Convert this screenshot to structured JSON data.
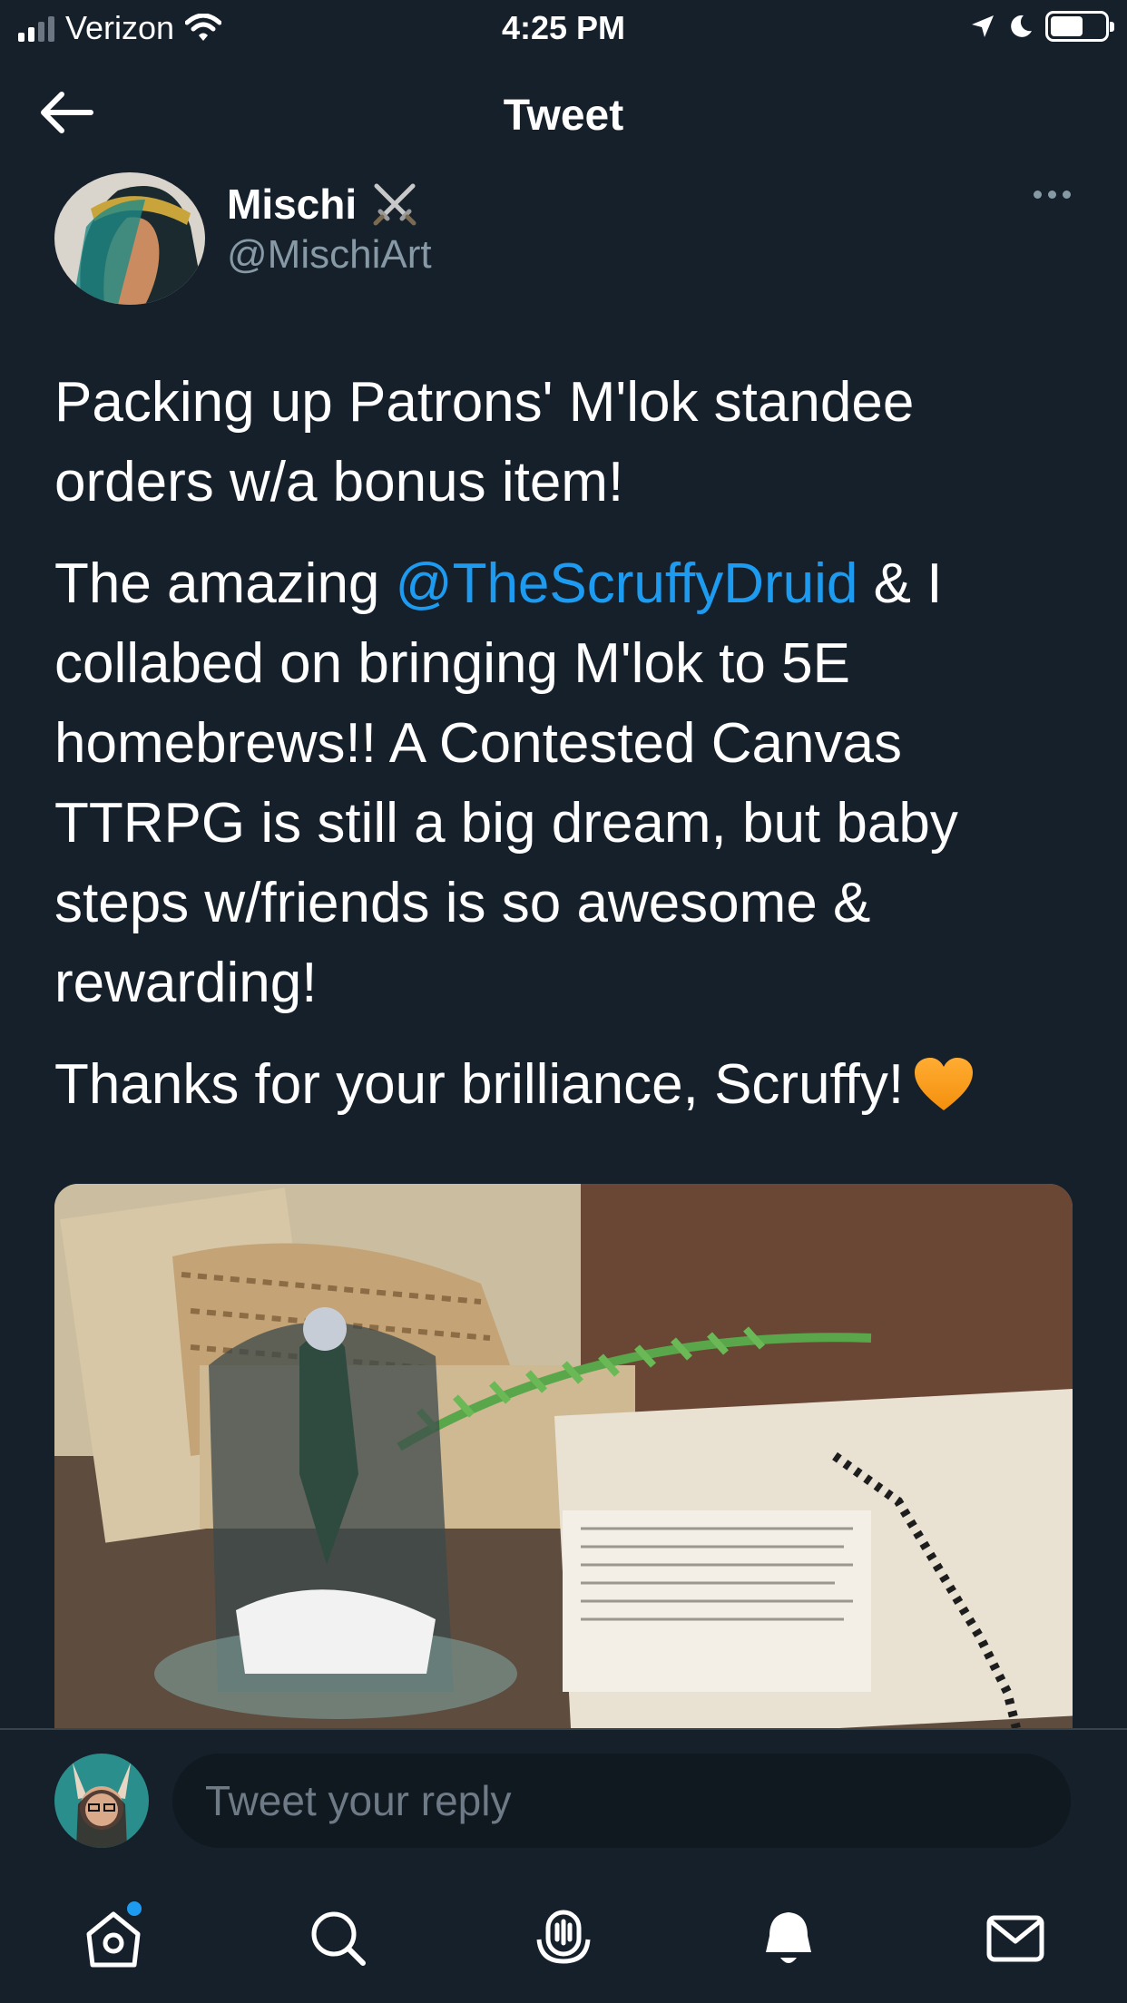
{
  "status_bar": {
    "carrier": "Verizon",
    "time": "4:25 PM",
    "battery_level": 0.6,
    "icons": [
      "signal-icon",
      "wifi-icon",
      "location-icon",
      "moon-icon",
      "battery-icon"
    ]
  },
  "nav": {
    "title": "Tweet",
    "back_icon": "arrow-left-icon"
  },
  "tweet": {
    "author": {
      "display_name": "Mischi",
      "badge_icon": "crossed-swords-icon",
      "handle": "@MischiArt"
    },
    "more_icon": "ellipsis-icon",
    "paragraph1": "Packing up Patrons' M'lok standee orders w/a bonus item!",
    "paragraph2_before": "The amazing ",
    "mention": "@TheScruffyDruid",
    "paragraph2_after": " & I collabed on bringing M'lok to 5E homebrews!!  A Contested Canvas TTRPG is still a big dream, but baby steps w/friends is so awesome & rewarding!",
    "paragraph3": "Thanks for your brilliance, Scruffy!",
    "emoji": "orange-heart-icon",
    "mention_color": "#1d9bf0"
  },
  "reply": {
    "placeholder": "Tweet your reply"
  },
  "tabbar": {
    "items": [
      "home-icon",
      "search-icon",
      "spaces-icon",
      "bell-icon",
      "mail-icon"
    ],
    "home_has_notification": true
  },
  "colors": {
    "background": "#15202b",
    "secondary_text": "#8899a6",
    "accent": "#1d9bf0",
    "divider": "#38444d"
  }
}
